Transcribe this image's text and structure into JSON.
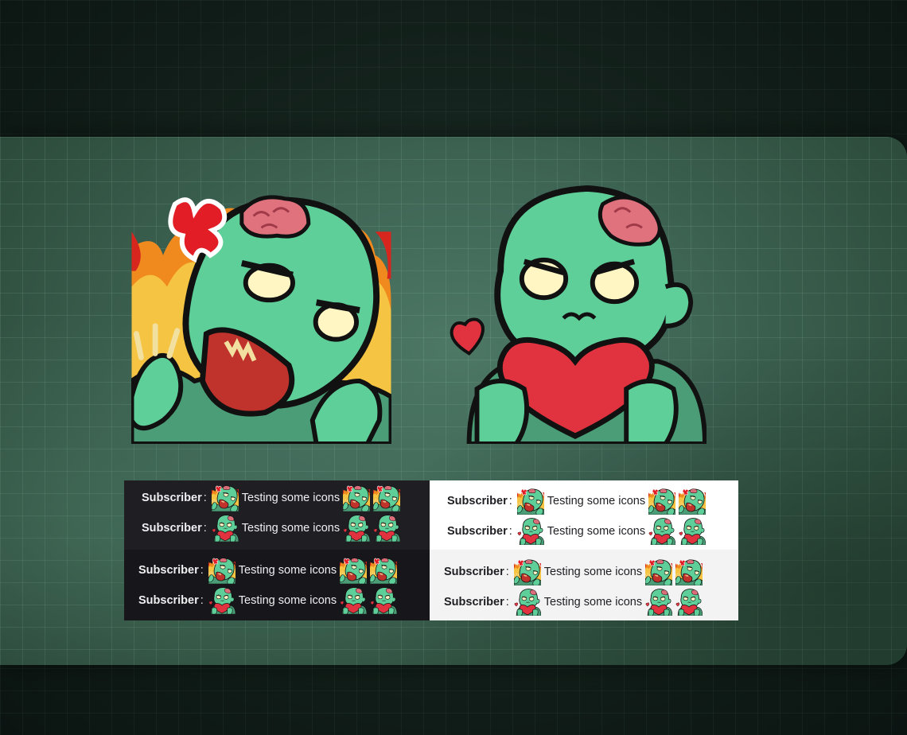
{
  "chat_preview": {
    "username": "Subscriber",
    "separator": ":",
    "message": "Testing some icons",
    "panels": [
      {
        "theme": "dark",
        "rows": [
          {
            "emote": "rage-zombie-icon"
          },
          {
            "emote": "love-zombie-icon"
          }
        ]
      },
      {
        "theme": "light",
        "rows": [
          {
            "emote": "rage-zombie-icon"
          },
          {
            "emote": "love-zombie-icon"
          }
        ]
      },
      {
        "theme": "dark",
        "rows": [
          {
            "emote": "rage-zombie-icon"
          },
          {
            "emote": "love-zombie-icon"
          }
        ]
      },
      {
        "theme": "light",
        "rows": [
          {
            "emote": "rage-zombie-icon"
          },
          {
            "emote": "love-zombie-icon"
          }
        ]
      }
    ]
  },
  "emotes": [
    {
      "name": "rage-zombie-icon"
    },
    {
      "name": "love-zombie-icon"
    }
  ],
  "colors": {
    "background": "#121f1a",
    "card": "#3e6454",
    "zombie_skin": "#5fcf9a",
    "brain": "#e0727e",
    "heart": "#e1323f",
    "fire": "#f08a1e",
    "dark_panel": "#1f1e23",
    "light_panel": "#ffffff"
  }
}
